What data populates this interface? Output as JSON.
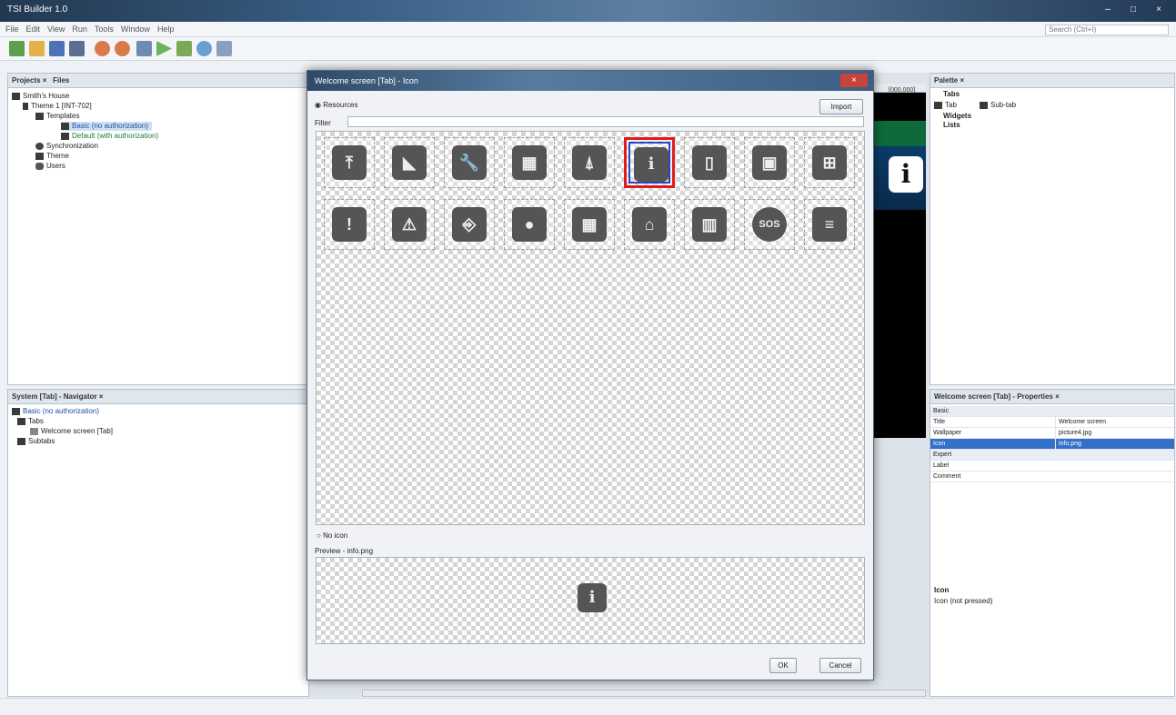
{
  "app": {
    "title": "TSI Builder 1.0"
  },
  "menu": {
    "items": [
      "File",
      "Edit",
      "View",
      "Run",
      "Tools",
      "Window",
      "Help"
    ],
    "search_placeholder": "Search (Ctrl+I)"
  },
  "projects": {
    "tab_projects": "Projects ×",
    "tab_files": "Files",
    "tree": [
      "Smith's House",
      "Theme 1 [INT-702]",
      "Templates",
      "Basic (no authorization)",
      "Default (with authorization)",
      "Synchronization",
      "Theme",
      "Users"
    ]
  },
  "navigator": {
    "title": "System [Tab] - Navigator ×",
    "tree": [
      "Basic (no authorization)",
      "Tabs",
      "Welcome screen [Tab]",
      "Subtabs"
    ]
  },
  "palette": {
    "title": "Palette ×",
    "sections": [
      "Tabs",
      "Widgets",
      "Lists"
    ],
    "tab_items": [
      "Tab",
      "Sub-tab"
    ]
  },
  "properties": {
    "title": "Welcome screen [Tab] - Properties ×",
    "groups": [
      "Basic",
      "Expert"
    ],
    "rows": [
      {
        "key": "Title",
        "value": "Welcome screen"
      },
      {
        "key": "Wallpaper",
        "value": "picture4.jpg"
      },
      {
        "key": "Icon",
        "value": "info.png"
      },
      {
        "key": "Label",
        "value": ""
      },
      {
        "key": "Comment",
        "value": ""
      }
    ],
    "help_title": "Icon",
    "help_text": "Icon (not pressed)"
  },
  "preview": {
    "coords": "[000,000]"
  },
  "dialog": {
    "title": "Welcome screen [Tab] - Icon",
    "resources_label": "Resources",
    "import_label": "Import",
    "filter_label": "Filter",
    "no_icon_label": "No icon",
    "preview_label": "Preview - info.png",
    "ok_label": "OK",
    "cancel_label": "Cancel",
    "icons": [
      {
        "name": "calendar-icon",
        "glyph": "⤒"
      },
      {
        "name": "camera-icon",
        "glyph": "◣"
      },
      {
        "name": "wrench-icon",
        "glyph": "🔧"
      },
      {
        "name": "calculator-icon",
        "glyph": "▦"
      },
      {
        "name": "tree-icon",
        "glyph": "⍋"
      },
      {
        "name": "info-icon",
        "glyph": "i"
      },
      {
        "name": "phone-icon",
        "glyph": "▯"
      },
      {
        "name": "screen-icon",
        "glyph": "▣"
      },
      {
        "name": "menu-icon",
        "glyph": "⊞"
      },
      {
        "name": "exclamation-icon",
        "glyph": "!"
      },
      {
        "name": "warning-icon",
        "glyph": "⚠"
      },
      {
        "name": "door-icon",
        "glyph": "⎆"
      },
      {
        "name": "bulb-icon",
        "glyph": "●"
      },
      {
        "name": "keypad-icon",
        "glyph": "▦"
      },
      {
        "name": "home-icon",
        "glyph": "⌂"
      },
      {
        "name": "meter-icon",
        "glyph": "▥"
      },
      {
        "name": "sos-icon",
        "glyph": "SOS"
      },
      {
        "name": "toggle-icon",
        "glyph": "≡"
      }
    ]
  }
}
